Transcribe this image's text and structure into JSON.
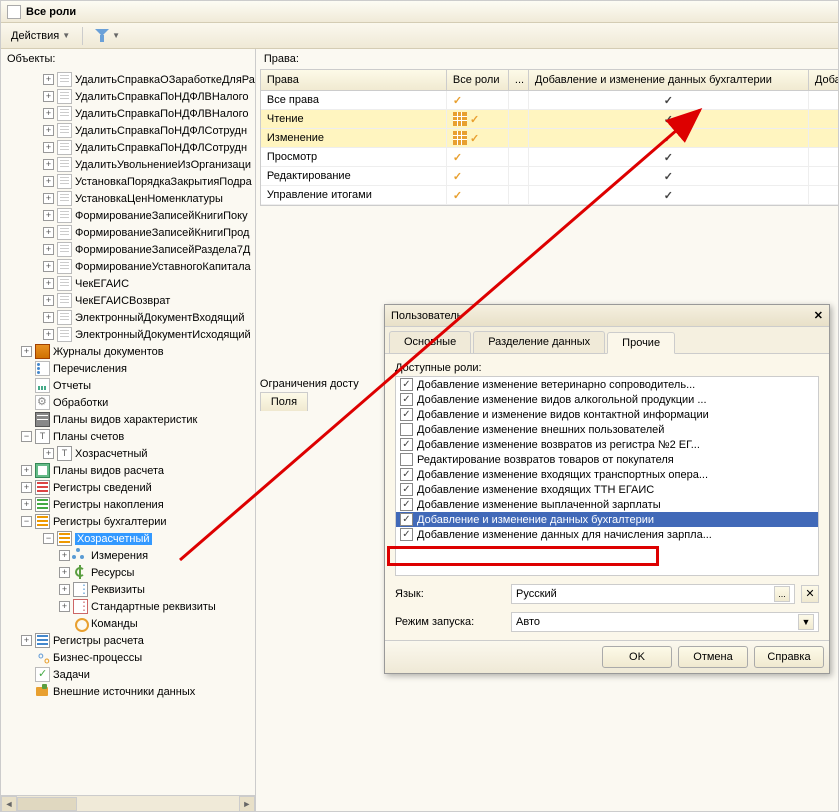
{
  "window": {
    "title": "Все роли"
  },
  "toolbar": {
    "actions": "Действия"
  },
  "left": {
    "title": "Объекты:",
    "docs": [
      "УдалитьСправкаОЗаработкеДляРа",
      "УдалитьСправкаПоНДФЛВНалого",
      "УдалитьСправкаПоНДФЛВНалого",
      "УдалитьСправкаПоНДФЛСотрудн",
      "УдалитьСправкаПоНДФЛСотрудн",
      "УдалитьУвольнениеИзОрганизаци",
      "УстановкаПорядкаЗакрытияПодра",
      "УстановкаЦенНоменклатуры",
      "ФормированиеЗаписейКнигиПоку",
      "ФормированиеЗаписейКнигиПрод",
      "ФормированиеЗаписейРаздела7Д",
      "ФормированиеУставногоКапитала",
      "ЧекЕГАИС",
      "ЧекЕГАИСВозврат",
      "ЭлектронныйДокументВходящий",
      "ЭлектронныйДокументИсходящий"
    ],
    "cat": {
      "journals": "Журналы документов",
      "enums": "Перечисления",
      "reports": "Отчеты",
      "proc": "Обработки",
      "char": "Планы видов характеристик",
      "accounts": "Планы счетов",
      "acc_item": "Хозрасчетный",
      "calc": "Планы видов расчета",
      "reg_info": "Регистры сведений",
      "reg_acc": "Регистры накопления",
      "reg_book": "Регистры бухгалтерии",
      "book_item": "Хозрасчетный",
      "dim": "Измерения",
      "res": "Ресурсы",
      "attr": "Реквизиты",
      "std": "Стандартные реквизиты",
      "cmd": "Команды",
      "reg_calc": "Регистры расчета",
      "bp": "Бизнес-процессы",
      "tasks": "Задачи",
      "ext": "Внешние источники данных"
    }
  },
  "rights": {
    "title": "Права:",
    "headers": {
      "name": "Права",
      "all": "Все роли",
      "add": "Добавление и изменение данных бухгалтерии",
      "last": "Добавл"
    },
    "rows": [
      {
        "name": "Все права",
        "all": true,
        "add": true,
        "icon": false,
        "hl": false
      },
      {
        "name": "Чтение",
        "all": true,
        "add": true,
        "icon": true,
        "hl": true
      },
      {
        "name": "Изменение",
        "all": true,
        "add": true,
        "icon": true,
        "hl": true
      },
      {
        "name": "Просмотр",
        "all": true,
        "add": true,
        "icon": false,
        "hl": false
      },
      {
        "name": "Редактирование",
        "all": true,
        "add": true,
        "icon": false,
        "hl": false
      },
      {
        "name": "Управление итогами",
        "all": true,
        "add": true,
        "icon": false,
        "hl": false
      }
    ],
    "restrict": "Ограничения досту",
    "fields": "Поля"
  },
  "dialog": {
    "title": "Пользователь",
    "tabs": {
      "main": "Основные",
      "div": "Разделение данных",
      "other": "Прочие"
    },
    "roles_label": "Доступные роли:",
    "roles": [
      {
        "label": "Добавление изменение ветеринарно сопроводитель...",
        "checked": true,
        "sel": false
      },
      {
        "label": "Добавление изменение видов алкогольной продукции ...",
        "checked": true,
        "sel": false
      },
      {
        "label": "Добавление и изменение видов контактной информации",
        "checked": true,
        "sel": false
      },
      {
        "label": "Добавление изменение внешних пользователей",
        "checked": false,
        "sel": false
      },
      {
        "label": "Добавление изменение возвратов из регистра №2 ЕГ...",
        "checked": true,
        "sel": false
      },
      {
        "label": "Редактирование возвратов товаров от покупателя",
        "checked": false,
        "sel": false
      },
      {
        "label": "Добавление изменение входящих транспортных опера...",
        "checked": true,
        "sel": false
      },
      {
        "label": "Добавление изменение входящих ТТН ЕГАИС",
        "checked": true,
        "sel": false
      },
      {
        "label": "Добавление изменение выплаченной зарплаты",
        "checked": true,
        "sel": false
      },
      {
        "label": "Добавление и изменение данных бухгалтерии",
        "checked": true,
        "sel": true
      },
      {
        "label": "Добавление изменение данных для начисления зарпла...",
        "checked": true,
        "sel": false
      }
    ],
    "lang_label": "Язык:",
    "lang_value": "Русский",
    "mode_label": "Режим запуска:",
    "mode_value": "Авто",
    "buttons": {
      "ok": "OK",
      "cancel": "Отмена",
      "help": "Справка"
    }
  }
}
